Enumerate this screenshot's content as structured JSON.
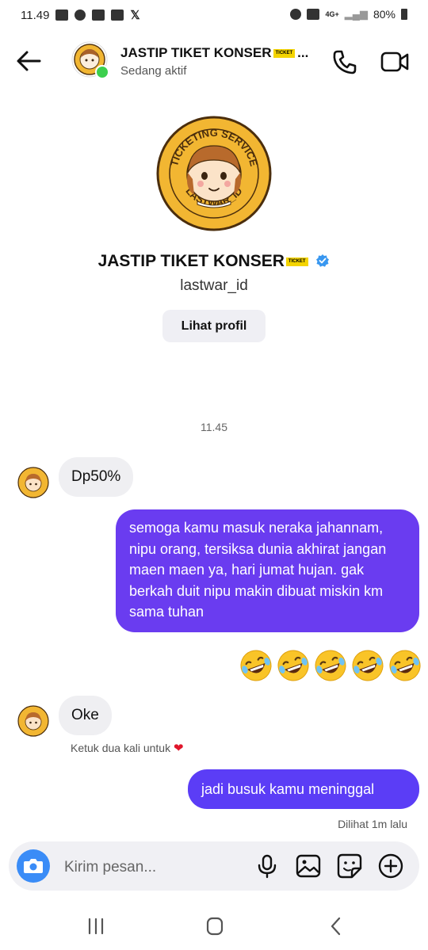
{
  "status_bar": {
    "time": "11.49",
    "battery": "80%",
    "network": "4G+"
  },
  "header": {
    "name": "JASTIP TIKET KONSER",
    "name_tag": "TICKET",
    "ellipsis": "...",
    "status": "Sedang aktif"
  },
  "profile": {
    "name": "JASTIP TIKET KONSER",
    "name_tag": "TICKET",
    "handle": "lastwar_id",
    "view_profile_label": "Lihat profil",
    "logo_text_top": "TICKETING SERVICE",
    "logo_text_bottom": "LASTWAR_ID"
  },
  "conversation": {
    "timestamp": "11.45",
    "messages": [
      {
        "from": "them",
        "text": "Dp50%"
      },
      {
        "from": "me",
        "text": "semoga kamu masuk neraka jahannam, nipu orang, tersiksa dunia akhirat jangan maen maen ya, hari jumat hujan. gak berkah duit nipu makin dibuat miskin km sama tuhan"
      },
      {
        "from": "me",
        "text": "🤣🤣🤣🤣🤣"
      },
      {
        "from": "them",
        "text": "Oke"
      },
      {
        "from": "me",
        "text": "jadi busuk kamu meninggal"
      }
    ],
    "double_tap_hint": "Ketuk dua kali untuk",
    "seen_label": "Dilihat 1m lalu"
  },
  "composer": {
    "placeholder": "Kirim pesan..."
  },
  "colors": {
    "outgoing_bubble": "#6a3cf0",
    "incoming_bubble": "#efeff2",
    "camera_button": "#3a8cf7",
    "online": "#3ccf4e"
  }
}
